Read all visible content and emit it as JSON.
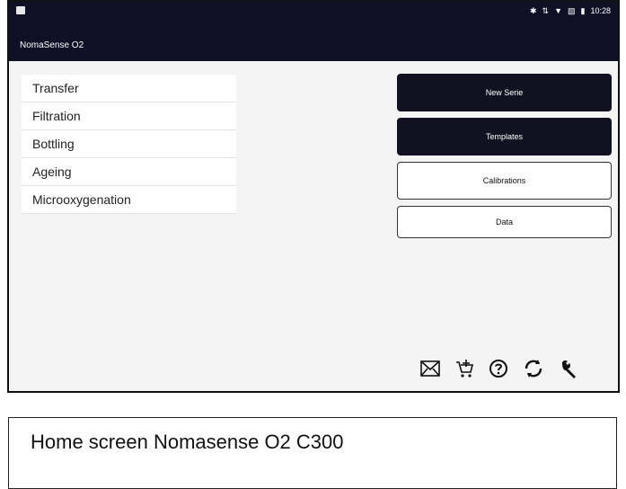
{
  "status": {
    "time": "10:28",
    "icons": [
      "bluetooth-icon",
      "signal-icon",
      "wifi-icon",
      "no-sim-icon",
      "battery-icon"
    ]
  },
  "app": {
    "title": "NomaSense O2"
  },
  "menu": {
    "items": [
      "Transfer",
      "Filtration",
      "Bottling",
      "Ageing",
      "Microoxygenation"
    ]
  },
  "buttons": {
    "new_serie": "New Serie",
    "templates": "Templates",
    "calibrations": "Calibrations",
    "data": "Data"
  },
  "toolbar": {
    "icons": [
      "mail-icon",
      "cart-add-icon",
      "help-icon",
      "sync-icon",
      "wrench-icon"
    ]
  },
  "caption": {
    "text": "Home screen Nomasense O2 C300"
  }
}
